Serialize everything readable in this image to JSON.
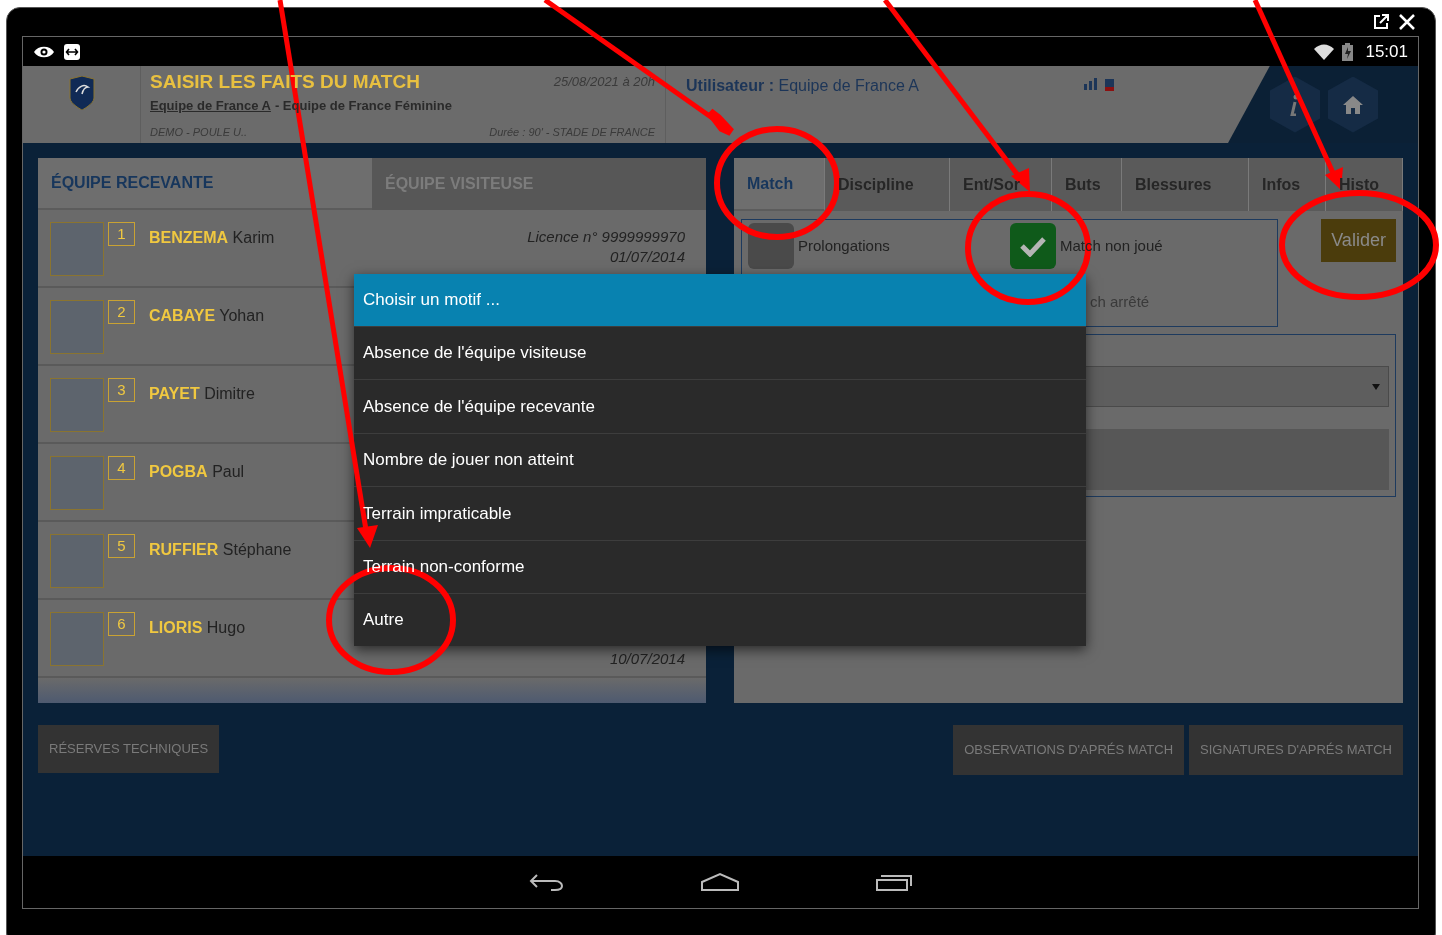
{
  "status_bar": {
    "time": "15:01"
  },
  "header": {
    "title": "SAISIR LES FAITS DU MATCH",
    "home_team": "Equipe de France A",
    "away_team": "- Equipe de France Féminine",
    "competition": "DEMO - POULE U..",
    "date": "25/08/2021 à 20h",
    "details": "Durée : 90' - STADE DE FRANCE",
    "user_label": "Utilisateur :",
    "user": "Equipe de France A"
  },
  "team_tabs": [
    {
      "label": "ÉQUIPE RECEVANTE",
      "selected": true
    },
    {
      "label": "ÉQUIPE VISITEUSE",
      "selected": false
    }
  ],
  "players": [
    {
      "number": "1",
      "last_name": "BENZEMA",
      "first_name": "Karim",
      "licence": "Licence n° 9999999970",
      "date": "01/07/2014"
    },
    {
      "number": "2",
      "last_name": "CABAYE",
      "first_name": "Yohan"
    },
    {
      "number": "3",
      "last_name": "PAYET",
      "first_name": "Dimitre"
    },
    {
      "number": "4",
      "last_name": "POGBA",
      "first_name": "Paul"
    },
    {
      "number": "5",
      "last_name": "RUFFIER",
      "first_name": "Stéphane"
    },
    {
      "number": "6",
      "last_name": "LIORIS",
      "first_name": "Hugo",
      "date": "10/07/2014"
    }
  ],
  "match_tabs": [
    {
      "label": "Match",
      "selected": true
    },
    {
      "label": "Discipline",
      "selected": false
    },
    {
      "label": "Ent/Sor",
      "selected": false
    },
    {
      "label": "Buts",
      "selected": false
    },
    {
      "label": "Blessures",
      "selected": false
    },
    {
      "label": "Infos",
      "selected": false
    },
    {
      "label": "Histo",
      "selected": false
    }
  ],
  "options": [
    {
      "label": "Prolongations",
      "checked": false
    },
    {
      "label": "Match non joué",
      "checked": true
    }
  ],
  "partial_option_label": "ch arrêté",
  "validate_button": "Valider",
  "dialog": {
    "title": "Choisir un motif ...",
    "items": [
      "Absence de l'équipe visiteuse",
      "Absence de l'équipe recevante",
      "Nombre de jouer non atteint",
      "Terrain impraticable",
      "Terrain non-conforme",
      "Autre"
    ]
  },
  "bottom_buttons": {
    "left": [
      "RÉSERVES TECHNIQUES"
    ],
    "right": [
      "OBSERVATIONS D'APRÉS MATCH",
      "SIGNATURES D'APRÉS MATCH"
    ]
  }
}
